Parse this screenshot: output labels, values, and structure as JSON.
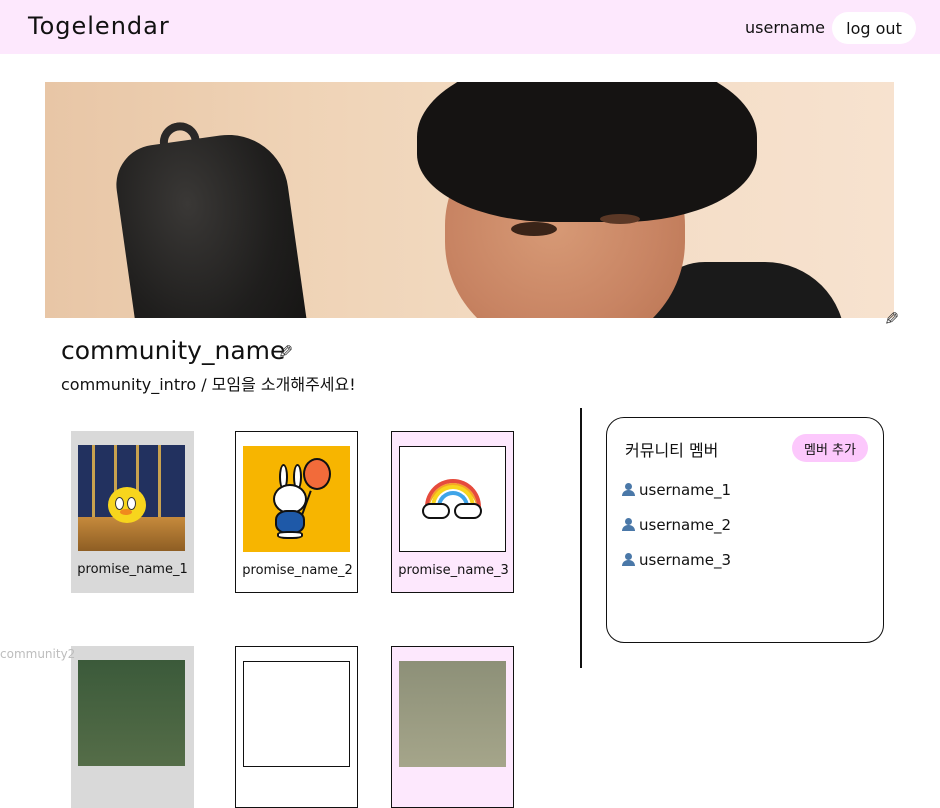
{
  "header": {
    "logo": "Togelendar",
    "username": "username",
    "logout_label": "log out",
    "bg_color": "#fde8fd"
  },
  "banner": {
    "edit_icon": "pencil-icon"
  },
  "community": {
    "name": "community_name",
    "intro": "community_intro / 모임을 소개해주세요!",
    "edit_icon": "pencil-icon"
  },
  "promises": [
    {
      "name": "promise_name_1",
      "image": "tweety-bird"
    },
    {
      "name": "promise_name_2",
      "image": "miffy-balloon"
    },
    {
      "name": "promise_name_3",
      "image": "rainbow-clouds"
    }
  ],
  "members_panel": {
    "title": "커뮤니티 멤버",
    "add_label": "멤버 추가",
    "accent_color": "#fcc8fc",
    "members": [
      {
        "name": "username_1",
        "icon": "user-icon"
      },
      {
        "name": "username_2",
        "icon": "user-icon"
      },
      {
        "name": "username_3",
        "icon": "user-icon"
      }
    ]
  },
  "overflow_label": "community2"
}
